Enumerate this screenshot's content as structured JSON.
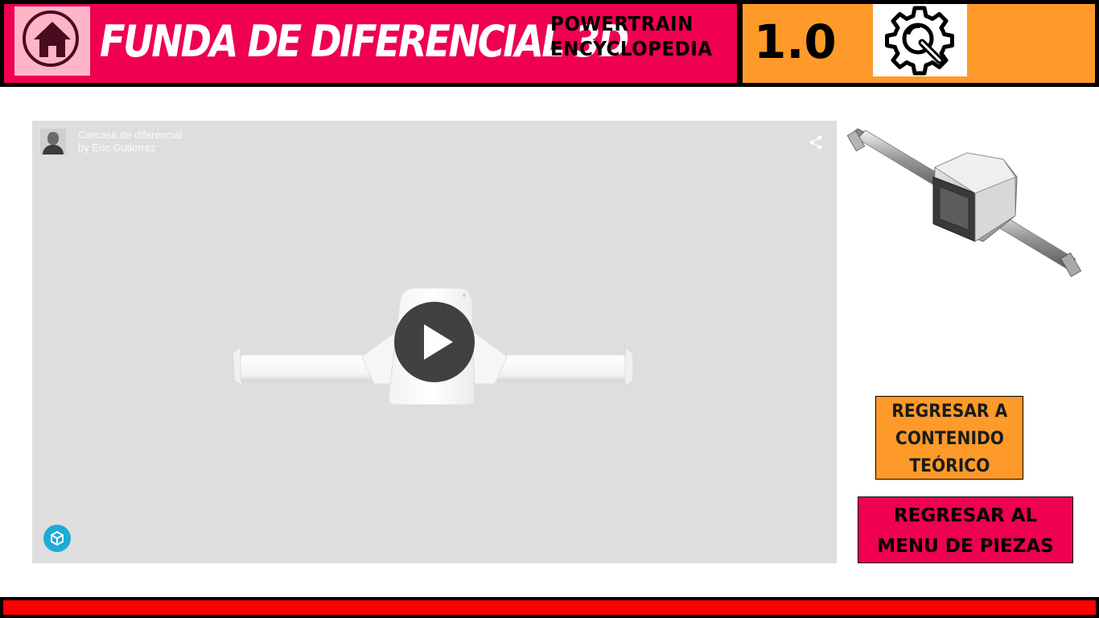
{
  "header": {
    "title": "FUNDA DE DIFERENCIAL 3D",
    "brand_line1": "POWERTRAIN",
    "brand_line2": "ENCYCLOPEDIA",
    "version": "1.0",
    "home_icon": "home-icon",
    "settings_icon": "gear-wrench-icon"
  },
  "viewer": {
    "model_title": "Carcasa de diferencial",
    "model_author": "by Eric Gutierrez",
    "play_icon": "play-icon",
    "share_icon": "share-icon",
    "logo_icon": "sketchfab-cube-icon"
  },
  "buttons": {
    "teoria": [
      "REGRESAR A",
      "CONTENIDO",
      "TEÓRICO"
    ],
    "menu": [
      "REGRESAR AL",
      "MENU DE PIEZAS"
    ]
  },
  "colors": {
    "header_pink": "#f00051",
    "header_orange": "#fd9a2a",
    "footer_red": "#ff0000",
    "viewer_bg": "#dedede"
  }
}
